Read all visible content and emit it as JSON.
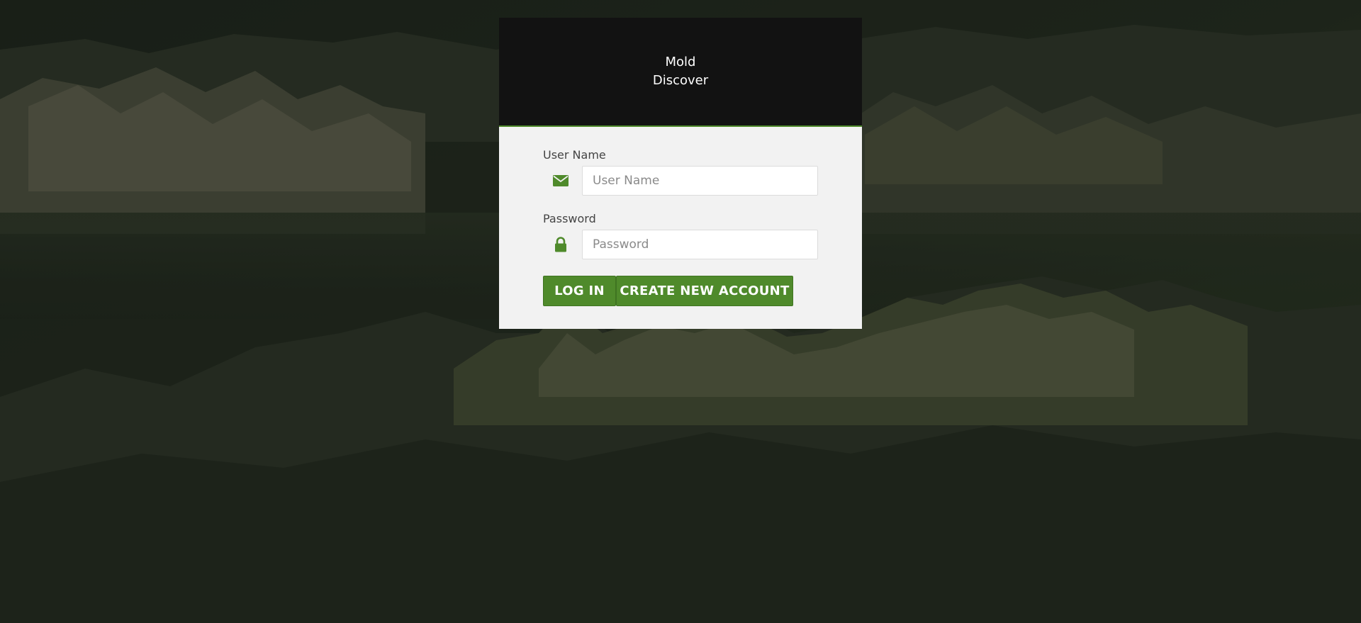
{
  "header": {
    "title_line1": "Mold",
    "title_line2": "Discover"
  },
  "form": {
    "username": {
      "label": "User Name",
      "placeholder": "User Name",
      "value": "",
      "icon": "envelope-icon"
    },
    "password": {
      "label": "Password",
      "placeholder": "Password",
      "value": "",
      "icon": "lock-icon"
    },
    "login_label": "LOG IN",
    "create_label": "CREATE NEW ACCOUNT"
  },
  "colors": {
    "accent": "#4f8a2b",
    "header_bg": "#121212",
    "card_bg": "#f2f2f2"
  }
}
